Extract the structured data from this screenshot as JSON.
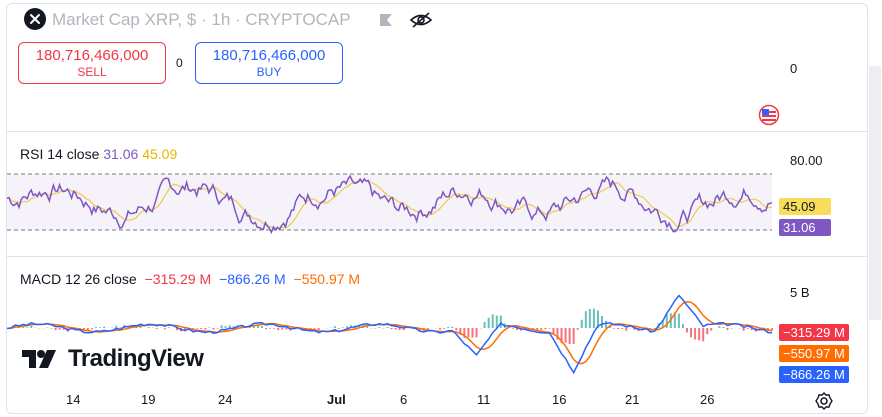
{
  "header": {
    "title": "Market Cap XRP, $ · 1h · CRYPTOCAP"
  },
  "trade": {
    "sell_value": "180,716,466,000",
    "sell_label": "SELL",
    "spread": "0",
    "buy_value": "180,716,466,000",
    "buy_label": "BUY"
  },
  "price_axis": {
    "zero_label": "0"
  },
  "rsi": {
    "label": "RSI 14 close",
    "value1": "31.06",
    "value2": "45.09",
    "axis_top": "80.00",
    "tag_ma": "45.09",
    "tag_rsi": "31.06",
    "rsi_color": "#7e57c2",
    "ma_color": "#f2c94c",
    "upper_band": 70,
    "lower_band": 30
  },
  "macd": {
    "label": "MACD 12 26 close",
    "hist": "−315.29 M",
    "macd": "−866.26 M",
    "signal": "−550.97 M",
    "axis_top": "5 B",
    "tag_hist": "−315.29 M",
    "tag_signal": "−550.97 M",
    "tag_macd": "−866.26 M",
    "hist_color": "#f23645",
    "macd_color": "#2962ff",
    "signal_color": "#ff6d00"
  },
  "x_axis": {
    "ticks": [
      "14",
      "19",
      "24",
      "Jul",
      "6",
      "11",
      "16",
      "21",
      "26"
    ]
  },
  "branding": {
    "logo_text": "TradingView"
  },
  "icons": [
    "close-icon",
    "flag-icon",
    "eye-off-icon",
    "currency-flag-icon",
    "settings-gear-icon"
  ]
}
